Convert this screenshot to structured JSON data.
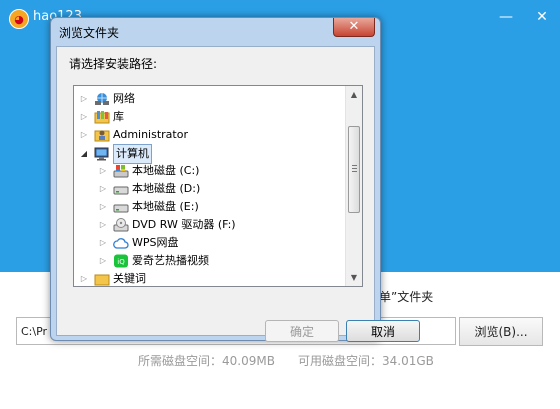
{
  "installer": {
    "title": "hao123...",
    "logo_glyph": "◕",
    "minimize_glyph": "—",
    "close_glyph": "✕",
    "hint_text": "菜单”文件夹",
    "path_value": "C:\\Pr",
    "browse_label": "浏览(B)...",
    "required_space": "所需磁盘空间：40.09MB",
    "available_space": "可用磁盘空间：34.01GB",
    "accent_color": "#2b9fe6"
  },
  "dialog": {
    "title": "浏览文件夹",
    "close_glyph": "✕",
    "prompt": "请选择安装路径:",
    "ok_label": "确定",
    "cancel_label": "取消",
    "tree": [
      {
        "label": "网络",
        "icon": "network-icon",
        "level": 0,
        "expanded": false,
        "selected": false
      },
      {
        "label": "库",
        "icon": "library-icon",
        "level": 0,
        "expanded": false,
        "selected": false
      },
      {
        "label": "Administrator",
        "icon": "user-folder-icon",
        "level": 0,
        "expanded": false,
        "selected": false
      },
      {
        "label": "计算机",
        "icon": "computer-icon",
        "level": 0,
        "expanded": true,
        "selected": true
      },
      {
        "label": "本地磁盘 (C:)",
        "icon": "system-drive-icon",
        "level": 1,
        "expanded": false,
        "selected": false
      },
      {
        "label": "本地磁盘 (D:)",
        "icon": "drive-icon",
        "level": 1,
        "expanded": false,
        "selected": false
      },
      {
        "label": "本地磁盘 (E:)",
        "icon": "drive-icon",
        "level": 1,
        "expanded": false,
        "selected": false
      },
      {
        "label": "DVD RW 驱动器 (F:)",
        "icon": "dvd-drive-icon",
        "level": 1,
        "expanded": false,
        "selected": false
      },
      {
        "label": "WPS网盘",
        "icon": "cloud-drive-icon",
        "level": 1,
        "expanded": false,
        "selected": false
      },
      {
        "label": "爱奇艺热播视频",
        "icon": "iqiyi-icon",
        "level": 1,
        "expanded": false,
        "selected": false
      },
      {
        "label": "关键词",
        "icon": "folder-icon",
        "level": 0,
        "expanded": false,
        "selected": false
      }
    ]
  }
}
